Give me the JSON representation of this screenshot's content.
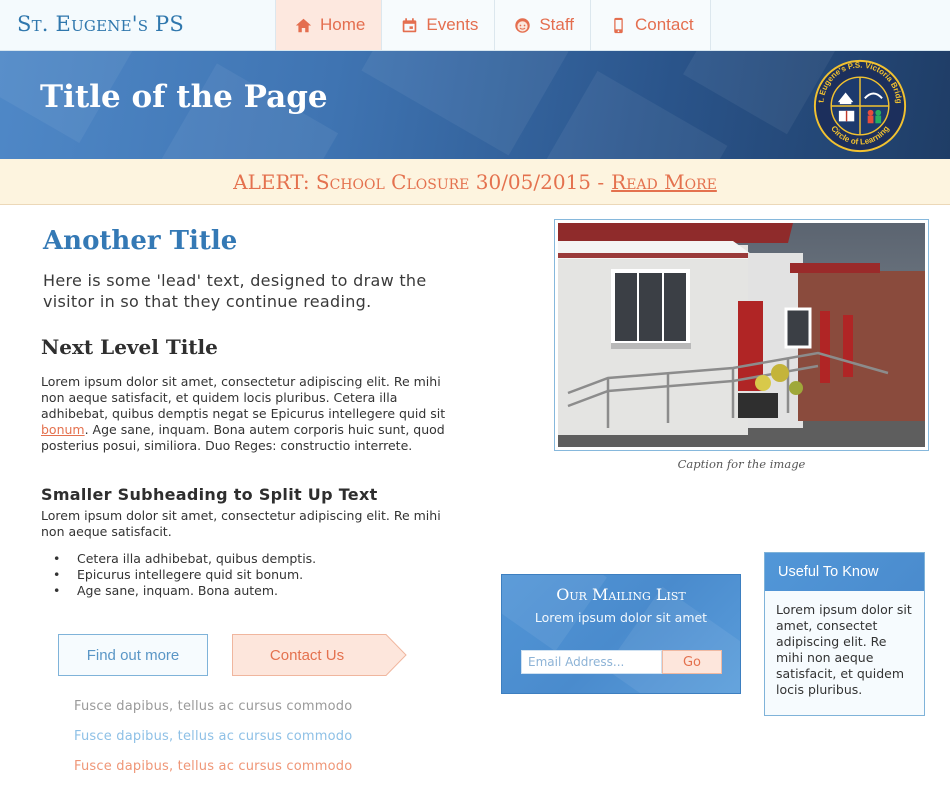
{
  "site": {
    "brand": "St. Eugene's PS"
  },
  "nav": {
    "items": [
      {
        "label": "Home",
        "icon": "home-icon",
        "active": true
      },
      {
        "label": "Events",
        "icon": "calendar-icon",
        "active": false
      },
      {
        "label": "Staff",
        "icon": "face-icon",
        "active": false
      },
      {
        "label": "Contact",
        "icon": "phone-icon",
        "active": false
      }
    ]
  },
  "hero": {
    "title": "Title of the Page",
    "crest": {
      "top_text": "St. Eugene's P.S. Victoria Bridge",
      "bottom_text": "Circle of Learning"
    }
  },
  "alert": {
    "text": "ALERT: School Closure 30/05/2015 -",
    "link": "Read More"
  },
  "content": {
    "title": "Another Title",
    "lead": "Here is some 'lead' text, designed to draw the visitor in so that they continue reading.",
    "subtitle": "Next Level Title",
    "para1_before": "Lorem ipsum dolor sit amet, consectetur adipiscing elit. Re mihi non aeque satisfacit, et quidem locis pluribus. Cetera illa adhibebat, quibus demptis negat se Epicurus intellegere quid sit ",
    "para1_link": "bonum",
    "para1_after": ". Age sane, inquam. Bona autem corporis huic sunt, quod posterius posui, similiora. Duo Reges: constructio interrete.",
    "subheading": "Smaller Subheading to Split Up Text",
    "para2": "Lorem ipsum dolor sit amet, consectetur adipiscing elit. Re mihi non aeque satisfacit.",
    "bullets": [
      "Cetera illa adhibebat, quibus demptis.",
      "Epicurus intellegere quid sit bonum.",
      "Age sane, inquam. Bona autem."
    ],
    "find_out_more": "Find out more",
    "contact_us": "Contact Us",
    "links": [
      "Fusce dapibus, tellus ac cursus commodo",
      "Fusce dapibus, tellus ac cursus commodo",
      "Fusce dapibus, tellus ac cursus commodo"
    ]
  },
  "photo": {
    "caption": "Caption for the image"
  },
  "mailing": {
    "title": "Our Mailing List",
    "subtitle": "Lorem ipsum dolor sit amet",
    "placeholder": "Email Address...",
    "button": "Go"
  },
  "useful": {
    "title": "Useful To Know",
    "body": "Lorem ipsum dolor sit amet, consectet adipiscing elit. Re mihi non aeque satisfacit, et quidem locis pluribus."
  },
  "colors": {
    "primary_blue": "#3479b5",
    "accent_orange": "#e4714e",
    "alert_bg": "#fdf4df",
    "nav_active_bg": "#fde8df"
  }
}
